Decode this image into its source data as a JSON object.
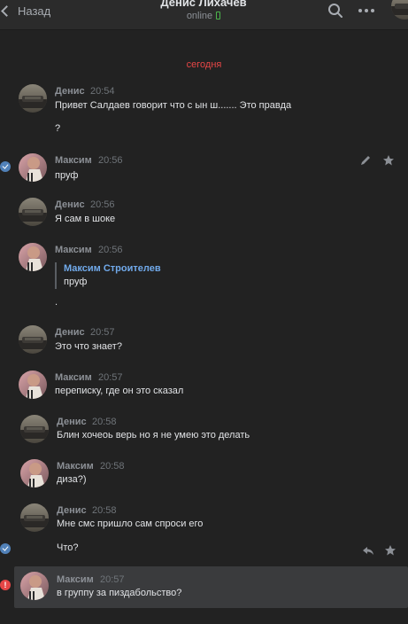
{
  "header": {
    "back_label": "Назад",
    "title": "Денис Лихачев",
    "status": "online",
    "icons": [
      "back-chevron-icon",
      "search-icon",
      "more-icon",
      "phone-icon"
    ]
  },
  "date_separator": "сегодня",
  "messages": [
    {
      "author": "Денис",
      "time": "20:54",
      "lines": [
        "Привет Салдаев говорит что с ын ш....... Это правда",
        "?"
      ]
    },
    {
      "author": "Максим",
      "time": "20:56",
      "lines": [
        "пруф"
      ]
    },
    {
      "author": "Денис",
      "time": "20:56",
      "lines": [
        "Я сам в шоке"
      ]
    },
    {
      "author": "Максим",
      "time": "20:56",
      "quote": {
        "author": "Максим Строителев",
        "text": "пруф"
      },
      "lines": [
        "."
      ]
    },
    {
      "author": "Денис",
      "time": "20:57",
      "lines": [
        "Это что знает?"
      ]
    },
    {
      "author": "Максим",
      "time": "20:57",
      "lines": [
        "переписку, где он это сказал"
      ]
    },
    {
      "author": "Денис",
      "time": "20:58",
      "lines": [
        "Блин хочеоь верь но я не умею это делать"
      ]
    },
    {
      "author": "Максим",
      "time": "20:58",
      "lines": [
        "диза?)"
      ]
    },
    {
      "author": "Денис",
      "time": "20:58",
      "lines": [
        "Мне смс пришло сам спроси его",
        "Что?"
      ]
    },
    {
      "author": "Максим",
      "time": "20:57",
      "lines": [
        "в группу за пиздабольство?"
      ]
    }
  ],
  "colors": {
    "background": "#222222",
    "accent_link": "#71aaeb",
    "date_red": "#e64646",
    "check_blue": "#5181b8",
    "online_green": "#4bb34b"
  }
}
